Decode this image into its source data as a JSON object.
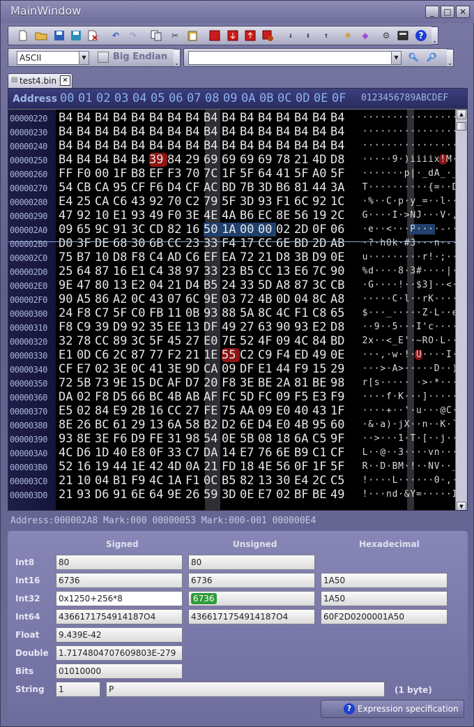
{
  "window": {
    "title": "MainWindow",
    "minimize": "_",
    "maximize": "□",
    "close": "✕"
  },
  "toolbar": {
    "encoding": "ASCII",
    "big_endian": "Big Endian",
    "search_value": ""
  },
  "tab": {
    "label": "test4.bin *",
    "close": "✕"
  },
  "header": {
    "address": "Address",
    "bytes": [
      "00",
      "01",
      "02",
      "03",
      "04",
      "05",
      "06",
      "07",
      "08",
      "09",
      "0A",
      "0B",
      "0C",
      "0D",
      "0E",
      "0F"
    ],
    "ascii": "0123456789ABCDEF"
  },
  "rows": [
    {
      "addr": "00000220",
      "bytes": [
        "B4",
        "B4",
        "B4",
        "B4",
        "B4",
        "B4",
        "B4",
        "B4",
        "B4",
        "B4",
        "B4",
        "B4",
        "B4",
        "B4",
        "B4",
        "B4"
      ],
      "ascii": "················"
    },
    {
      "addr": "00000230",
      "bytes": [
        "B4",
        "B4",
        "B4",
        "B4",
        "B4",
        "B4",
        "B4",
        "B4",
        "B4",
        "B4",
        "B4",
        "B4",
        "B4",
        "B4",
        "B4",
        "B4"
      ],
      "ascii": "················"
    },
    {
      "addr": "00000240",
      "bytes": [
        "B4",
        "B4",
        "B4",
        "B4",
        "B4",
        "B4",
        "B4",
        "B4",
        "B4",
        "B4",
        "B4",
        "B4",
        "B4",
        "B4",
        "B4",
        "B4"
      ],
      "ascii": "················"
    },
    {
      "addr": "00000250",
      "bytes": [
        "B4",
        "B4",
        "B4",
        "B4",
        "B4",
        "39",
        "84",
        "29",
        "69",
        "69",
        "69",
        "69",
        "78",
        "21",
        "4D",
        "D8"
      ],
      "ascii": "·····9·)iiiix!M·"
    },
    {
      "addr": "00000260",
      "bytes": [
        "FF",
        "F0",
        "00",
        "1F",
        "B8",
        "EF",
        "F3",
        "70",
        "7C",
        "1F",
        "5F",
        "64",
        "41",
        "5F",
        "A0",
        "5F"
      ],
      "ascii": "·······p|·_dA_·_"
    },
    {
      "addr": "00000270",
      "bytes": [
        "54",
        "CB",
        "CA",
        "95",
        "CF",
        "F6",
        "D4",
        "CF",
        "AC",
        "BD",
        "7B",
        "3D",
        "B6",
        "81",
        "44",
        "3A"
      ],
      "ascii": "T··········{=··D:"
    },
    {
      "addr": "00000280",
      "bytes": [
        "E4",
        "25",
        "CA",
        "C6",
        "43",
        "92",
        "70",
        "C2",
        "79",
        "5F",
        "3D",
        "93",
        "F1",
        "6C",
        "92",
        "1C"
      ],
      "ascii": "·%··C·p·y_=··l··"
    },
    {
      "addr": "00000290",
      "bytes": [
        "47",
        "92",
        "10",
        "E1",
        "93",
        "49",
        "F0",
        "3E",
        "4E",
        "4A",
        "B6",
        "EC",
        "8E",
        "56",
        "19",
        "2C"
      ],
      "ascii": "G····I·>NJ···V·,"
    },
    {
      "addr": "000002A0",
      "bytes": [
        "09",
        "65",
        "9C",
        "91",
        "3C",
        "CD",
        "82",
        "16",
        "50",
        "1A",
        "00",
        "00",
        "02",
        "2D",
        "0F",
        "06"
      ],
      "ascii": "·e··<···P····-··"
    },
    {
      "addr": "000002B0",
      "bytes": [
        "D0",
        "3F",
        "DE",
        "68",
        "30",
        "6B",
        "CC",
        "23",
        "33",
        "F4",
        "17",
        "CC",
        "6E",
        "BD",
        "2D",
        "AB"
      ],
      "ascii": "·?·h0k·#3···n·-·"
    },
    {
      "addr": "000002C0",
      "bytes": [
        "75",
        "B7",
        "10",
        "D8",
        "F8",
        "C4",
        "AD",
        "C6",
        "EF",
        "EA",
        "72",
        "21",
        "D8",
        "3B",
        "D9",
        "0E"
      ],
      "ascii": "u·········r!·;··"
    },
    {
      "addr": "000002D0",
      "bytes": [
        "25",
        "64",
        "87",
        "16",
        "E1",
        "C4",
        "38",
        "97",
        "33",
        "23",
        "B5",
        "CC",
        "13",
        "E6",
        "7C",
        "90"
      ],
      "ascii": "%d····8·3#····|·"
    },
    {
      "addr": "000002E0",
      "bytes": [
        "9E",
        "47",
        "80",
        "13",
        "E2",
        "04",
        "21",
        "D4",
        "B5",
        "24",
        "33",
        "5D",
        "A8",
        "87",
        "3C",
        "CB"
      ],
      "ascii": "·G····!··$3]··<·"
    },
    {
      "addr": "000002F0",
      "bytes": [
        "90",
        "A5",
        "86",
        "A2",
        "0C",
        "43",
        "07",
        "6C",
        "9E",
        "03",
        "72",
        "4B",
        "0D",
        "04",
        "8C",
        "A8"
      ],
      "ascii": "·····C·l··rK····"
    },
    {
      "addr": "00000300",
      "bytes": [
        "24",
        "F8",
        "C7",
        "5F",
        "C0",
        "FB",
        "11",
        "0B",
        "93",
        "88",
        "5A",
        "8C",
        "4C",
        "F1",
        "C8",
        "65"
      ],
      "ascii": "$···_·····Z·L··e"
    },
    {
      "addr": "00000310",
      "bytes": [
        "F8",
        "C9",
        "39",
        "D9",
        "92",
        "35",
        "EE",
        "13",
        "DF",
        "49",
        "27",
        "63",
        "90",
        "93",
        "E2",
        "D8"
      ],
      "ascii": "··9··5···I'c····"
    },
    {
      "addr": "00000320",
      "bytes": [
        "32",
        "78",
        "CC",
        "89",
        "3C",
        "5F",
        "45",
        "27",
        "E0",
        "7E",
        "52",
        "4F",
        "09",
        "4C",
        "84",
        "BD"
      ],
      "ascii": "2x··<_E'·~RO·L··"
    },
    {
      "addr": "00000330",
      "bytes": [
        "E1",
        "0D",
        "C6",
        "2C",
        "87",
        "77",
        "F2",
        "21",
        "1E",
        "55",
        "C2",
        "C9",
        "F4",
        "ED",
        "49",
        "0E"
      ],
      "ascii": "···,·w·!·U····I·"
    },
    {
      "addr": "00000340",
      "bytes": [
        "CF",
        "E7",
        "02",
        "3E",
        "0C",
        "41",
        "3E",
        "9D",
        "CA",
        "09",
        "DF",
        "E1",
        "44",
        "F9",
        "15",
        "29"
      ],
      "ascii": "···>·A>·····D··)"
    },
    {
      "addr": "00000350",
      "bytes": [
        "72",
        "5B",
        "73",
        "9E",
        "15",
        "DC",
        "AF",
        "D7",
        "20",
        "F8",
        "3E",
        "BE",
        "2A",
        "81",
        "BE",
        "98"
      ],
      "ascii": "r[s····· ·>·*···"
    },
    {
      "addr": "00000360",
      "bytes": [
        "DA",
        "02",
        "F8",
        "D5",
        "66",
        "BC",
        "4B",
        "AB",
        "AF",
        "FC",
        "5D",
        "FC",
        "09",
        "F5",
        "E3",
        "F9"
      ],
      "ascii": "····f·K···]·····"
    },
    {
      "addr": "00000370",
      "bytes": [
        "E5",
        "02",
        "84",
        "E9",
        "2B",
        "16",
        "CC",
        "27",
        "FE",
        "75",
        "AA",
        "09",
        "E0",
        "40",
        "43",
        "1F"
      ],
      "ascii": "····+··'·u···@C·"
    },
    {
      "addr": "00000380",
      "bytes": [
        "8E",
        "26",
        "BC",
        "61",
        "29",
        "13",
        "6A",
        "58",
        "B2",
        "D2",
        "6E",
        "D4",
        "E0",
        "4B",
        "95",
        "60"
      ],
      "ascii": "·&·a)·jX··n··K·`"
    },
    {
      "addr": "00000390",
      "bytes": [
        "93",
        "8E",
        "3E",
        "F6",
        "D9",
        "FE",
        "31",
        "98",
        "54",
        "0E",
        "5B",
        "08",
        "18",
        "6A",
        "C5",
        "9F"
      ],
      "ascii": "··>···1·T·[··j··"
    },
    {
      "addr": "000003A0",
      "bytes": [
        "4C",
        "D6",
        "1D",
        "40",
        "E8",
        "0F",
        "33",
        "C7",
        "DA",
        "14",
        "E7",
        "76",
        "6E",
        "B9",
        "C1",
        "CF"
      ],
      "ascii": "L··@··3····vn···"
    },
    {
      "addr": "000003B0",
      "bytes": [
        "52",
        "16",
        "19",
        "44",
        "1E",
        "42",
        "4D",
        "0A",
        "21",
        "FD",
        "18",
        "4E",
        "56",
        "0F",
        "1F",
        "5F"
      ],
      "ascii": "R··D·BM·!··NV··_"
    },
    {
      "addr": "000003C0",
      "bytes": [
        "21",
        "10",
        "04",
        "B1",
        "F9",
        "4C",
        "1A",
        "F1",
        "0C",
        "B5",
        "82",
        "13",
        "30",
        "E4",
        "2C",
        "C5"
      ],
      "ascii": "!····L······0·,·"
    },
    {
      "addr": "000003D0",
      "bytes": [
        "21",
        "93",
        "D6",
        "91",
        "6E",
        "64",
        "9E",
        "26",
        "59",
        "3D",
        "0E",
        "E7",
        "02",
        "BF",
        "BE",
        "49"
      ],
      "ascii": "!···nd·&Y=·····I"
    }
  ],
  "status": {
    "text": "Address:000002A8  Mark:000 00000053  Mark:000-001 000000E4"
  },
  "converter": {
    "col_signed": "Signed",
    "col_unsigned": "Unsigned",
    "col_hex": "Hexadecimal",
    "int8": {
      "label": "Int8",
      "signed": "80",
      "unsigned": "80"
    },
    "int16": {
      "label": "Int16",
      "signed": "6736",
      "unsigned": "6736",
      "hex": "1A50"
    },
    "int32": {
      "label": "Int32",
      "signed": "0x1250+256*8",
      "unsigned": "6736",
      "hex": "1A50"
    },
    "int64": {
      "label": "Int64",
      "signed": "4366171754914187O4",
      "unsigned": "4366171754914187O4",
      "hex": "60F2D0200001A50"
    },
    "float": {
      "label": "Float",
      "value": "9.439E-42"
    },
    "double": {
      "label": "Double",
      "value": "1.7174804707609803E-279"
    },
    "bits": {
      "label": "Bits",
      "value": "01010000"
    },
    "string": {
      "label": "String",
      "length": "1",
      "value": "P",
      "size": "(1 byte)"
    },
    "spec_button": "Expression specification"
  }
}
